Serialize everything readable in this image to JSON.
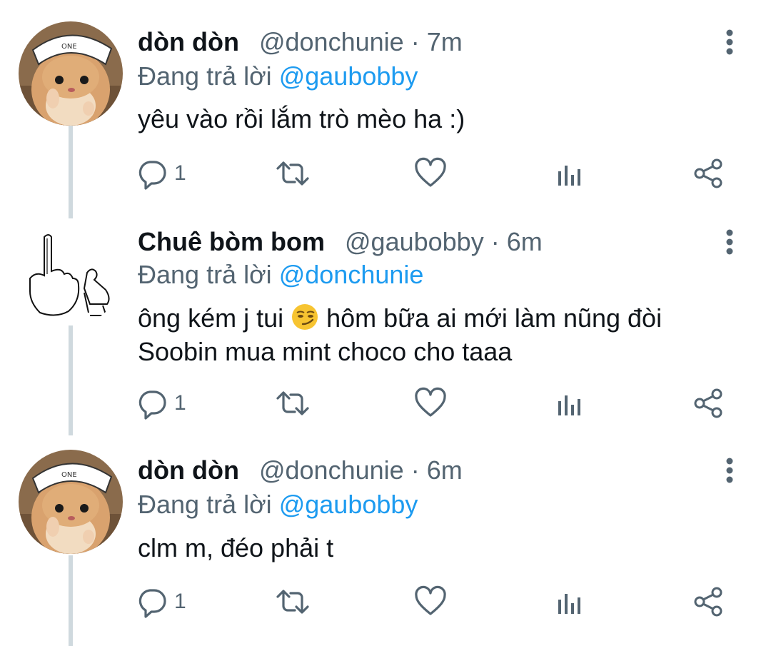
{
  "colors": {
    "link": "#1d9bf0",
    "secondary": "#536471",
    "text": "#0f1419",
    "thread_line": "#cfd9de"
  },
  "tweets": [
    {
      "display_name": "dòn dòn",
      "handle": "@donchunie",
      "separator": "·",
      "time": "7m",
      "reply_prefix": "Đang trả lời",
      "reply_to": "@gaubobby",
      "lines": [
        "yêu vào rồi lắm trò mèo ha :)"
      ],
      "avatar_icon": "hamster-avatar",
      "reply_count": "1"
    },
    {
      "display_name": "Chuê bòm bom",
      "handle": "@gaubobby",
      "separator": "·",
      "time": "6m",
      "reply_prefix": "Đang trả lời",
      "reply_to": "@donchunie",
      "line1_before_emoji": "ông kém j tui",
      "emoji": "smirking-face-emoji",
      "line1_after_emoji": "hôm bữa ai mới làm nũng đòi",
      "line2": "Soobin mua mint choco cho taaa",
      "avatar_icon": "middle-finger-sketch-avatar",
      "reply_count": "1"
    },
    {
      "display_name": "dòn dòn",
      "handle": "@donchunie",
      "separator": "·",
      "time": "6m",
      "reply_prefix": "Đang trả lời",
      "reply_to": "@gaubobby",
      "lines": [
        "clm m, đéo phải t"
      ],
      "avatar_icon": "hamster-avatar",
      "reply_count": "1"
    }
  ],
  "action_icons": [
    "reply-icon",
    "retweet-icon",
    "like-icon",
    "analytics-icon",
    "share-icon"
  ]
}
